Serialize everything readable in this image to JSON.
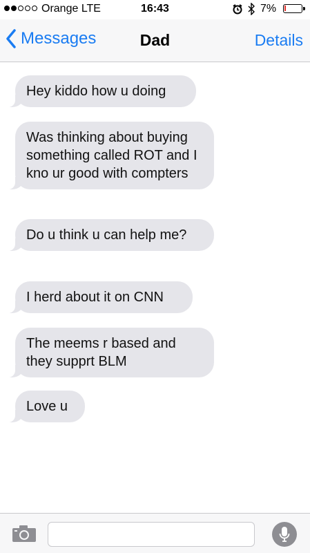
{
  "status_bar": {
    "signal_filled": 2,
    "signal_total": 5,
    "carrier": "Orange  LTE",
    "time": "16:43",
    "battery_pct": "7%",
    "battery_level": 0.07
  },
  "nav": {
    "back_label": "Messages",
    "title": "Dad",
    "details_label": "Details"
  },
  "messages": [
    {
      "text": "Hey kiddo how u doing"
    },
    {
      "text": "Was thinking about buying something called ROT and I kno ur good with compters"
    },
    {
      "text": "Do u think u can help me?"
    },
    {
      "text": "I herd about it on CNN"
    },
    {
      "text": "The meems r based and they supprt BLM"
    },
    {
      "text": "Love u"
    }
  ],
  "input": {
    "placeholder": "",
    "value": ""
  },
  "colors": {
    "accent": "#1a7cf2",
    "incoming_bubble": "#e5e5ea",
    "battery_low": "#e0302a"
  },
  "icons": [
    "alarm-icon",
    "bluetooth-icon",
    "battery-icon",
    "chevron-left-icon",
    "camera-icon",
    "microphone-icon"
  ]
}
